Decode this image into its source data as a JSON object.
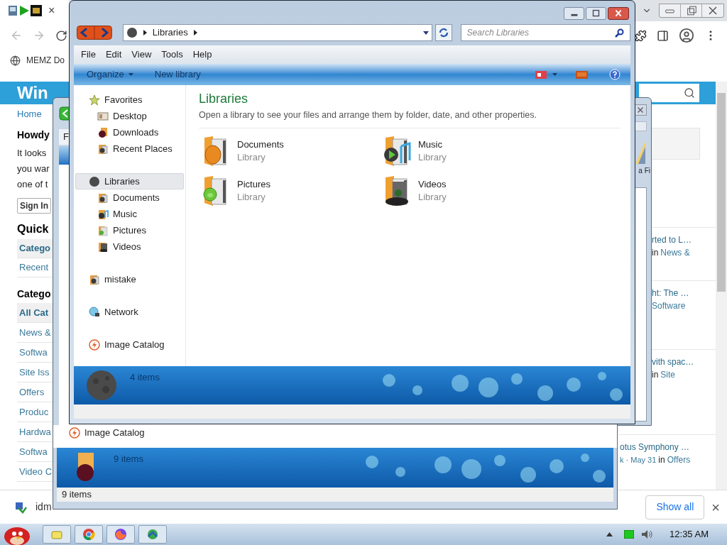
{
  "browser": {
    "tab_close": "×",
    "bookmark": "MEMZ Do",
    "page": {
      "site_title": "Win",
      "nav_link": "Home",
      "greeting": "Howdy",
      "intro_lines": [
        "It looks",
        "you war",
        "one of t"
      ],
      "sign_in": "Sign In",
      "quick_heading": "Quick",
      "quick_links": [
        {
          "label": "Catego",
          "selected": true
        },
        {
          "label": "Recent",
          "selected": false
        }
      ],
      "categories_heading": "Catego",
      "categories": [
        {
          "label": "All Cat",
          "selected": true
        },
        {
          "label": "News &",
          "selected": false
        },
        {
          "label": "Softwa",
          "selected": false
        },
        {
          "label": "Site Iss",
          "selected": false
        },
        {
          "label": "Offers",
          "selected": false
        },
        {
          "label": "Produc",
          "selected": false
        },
        {
          "label": "Hardwa",
          "selected": false
        },
        {
          "label": "Softwa",
          "selected": false
        },
        {
          "label": "Video C",
          "selected": false
        }
      ],
      "news": [
        {
          "title": "rted to L…",
          "prefix": "in",
          "category": "News &"
        },
        {
          "title": "ht: The …",
          "category": "Software"
        },
        {
          "title": "vith spac…",
          "prefix": "in",
          "category": "Site"
        },
        {
          "title": "otus Symphony …",
          "meta": "k · May 31",
          "prefix": "in",
          "category": "Offers"
        }
      ]
    },
    "download_bar": {
      "file": "idm",
      "show_all": "Show all",
      "close": "×"
    }
  },
  "back_window": {
    "menu_initial": "F",
    "partial_label": "a Fi",
    "nav_item": "Image Catalog",
    "details_count": "9 items",
    "status": "9 items"
  },
  "explorer": {
    "crumbs": [
      "Libraries"
    ],
    "search": {
      "placeholder": "Search Libraries"
    },
    "menu": [
      "File",
      "Edit",
      "View",
      "Tools",
      "Help"
    ],
    "commands": [
      {
        "label": "Organize",
        "dropdown": true
      },
      {
        "label": "New library",
        "dropdown": false
      }
    ],
    "nav": [
      {
        "label": "Favorites",
        "kind": "star",
        "selected": false,
        "children": [
          {
            "label": "Desktop",
            "kind": "desktop",
            "selected": false
          },
          {
            "label": "Downloads",
            "kind": "spiky",
            "selected": false
          },
          {
            "label": "Recent Places",
            "kind": "folder",
            "selected": false
          }
        ]
      },
      {
        "label": "Libraries",
        "kind": "disc",
        "selected": true,
        "children": [
          {
            "label": "Documents",
            "kind": "folder",
            "selected": false
          },
          {
            "label": "Music",
            "kind": "music",
            "selected": false
          },
          {
            "label": "Pictures",
            "kind": "picture",
            "selected": false
          },
          {
            "label": "Videos",
            "kind": "film",
            "selected": false
          }
        ]
      },
      {
        "label": "mistake",
        "kind": "folder",
        "selected": false
      },
      {
        "label": "Network",
        "kind": "globe",
        "selected": false
      },
      {
        "label": "Image Catalog",
        "kind": "bolt",
        "selected": false
      }
    ],
    "heading": "Libraries",
    "description": "Open a library to see your files and arrange them by folder, date, and other properties.",
    "libraries": [
      {
        "name": "Documents",
        "type": "Library",
        "kind": "egg"
      },
      {
        "name": "Music",
        "type": "Library",
        "kind": "music"
      },
      {
        "name": "Pictures",
        "type": "Library",
        "kind": "face"
      },
      {
        "name": "Videos",
        "type": "Library",
        "kind": "film"
      }
    ],
    "details_count": "4 items"
  },
  "taskbar": {
    "apps": [
      {
        "kind": "folder"
      },
      {
        "kind": "chrome"
      },
      {
        "kind": "firefox"
      },
      {
        "kind": "globe"
      }
    ],
    "clock": "12:35 AM"
  }
}
